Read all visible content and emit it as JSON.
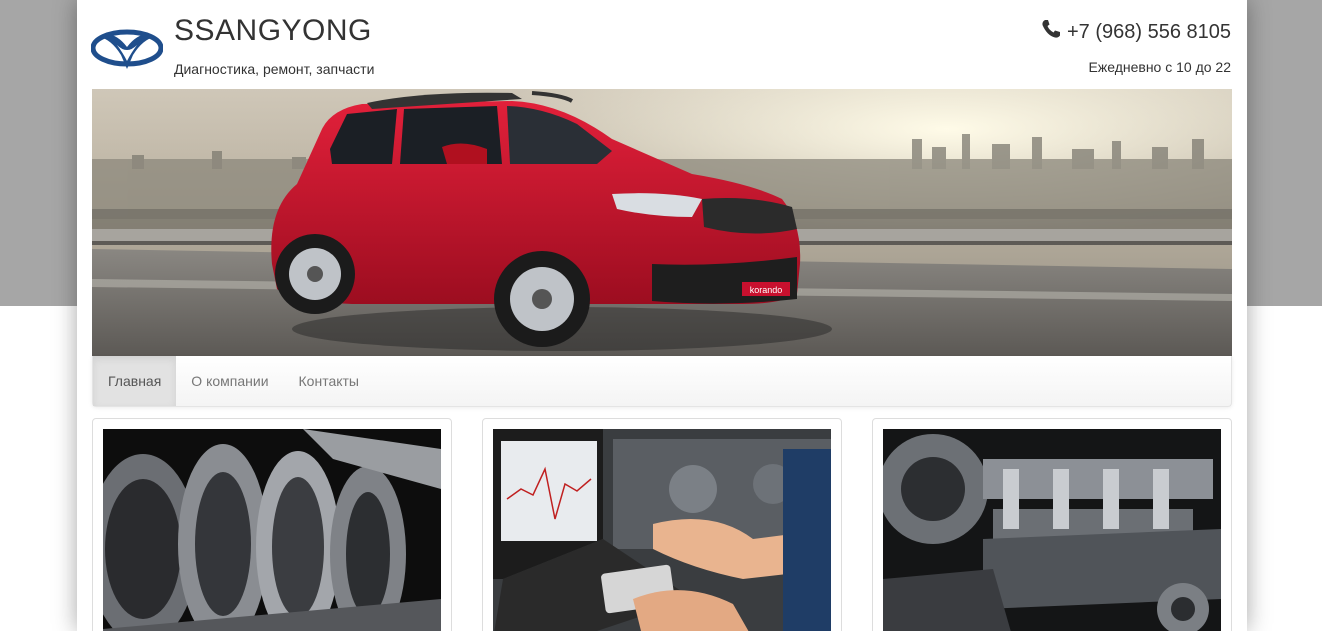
{
  "header": {
    "brand": "SSANGYONG",
    "tagline": "Диагностика, ремонт, запчасти",
    "phone": "+7 (968) 556 8105",
    "hours": "Ежедневно с 10 до 22"
  },
  "icons": {
    "logo": "ssangyong-logo-icon",
    "phone": "phone-icon"
  },
  "hero": {
    "plate_text": "korando"
  },
  "nav": {
    "items": [
      {
        "label": "Главная",
        "active": true
      },
      {
        "label": "О компании",
        "active": false
      },
      {
        "label": "Контакты",
        "active": false
      }
    ]
  },
  "cards": [
    {
      "image": "transmission-gears-photo"
    },
    {
      "image": "laptop-diagnostics-photo"
    },
    {
      "image": "engine-bay-photo"
    }
  ],
  "colors": {
    "brand_blue": "#1f4e8c",
    "car_red": "#c8102e",
    "text": "#333333",
    "outer_bg": "#a6a6a6"
  }
}
